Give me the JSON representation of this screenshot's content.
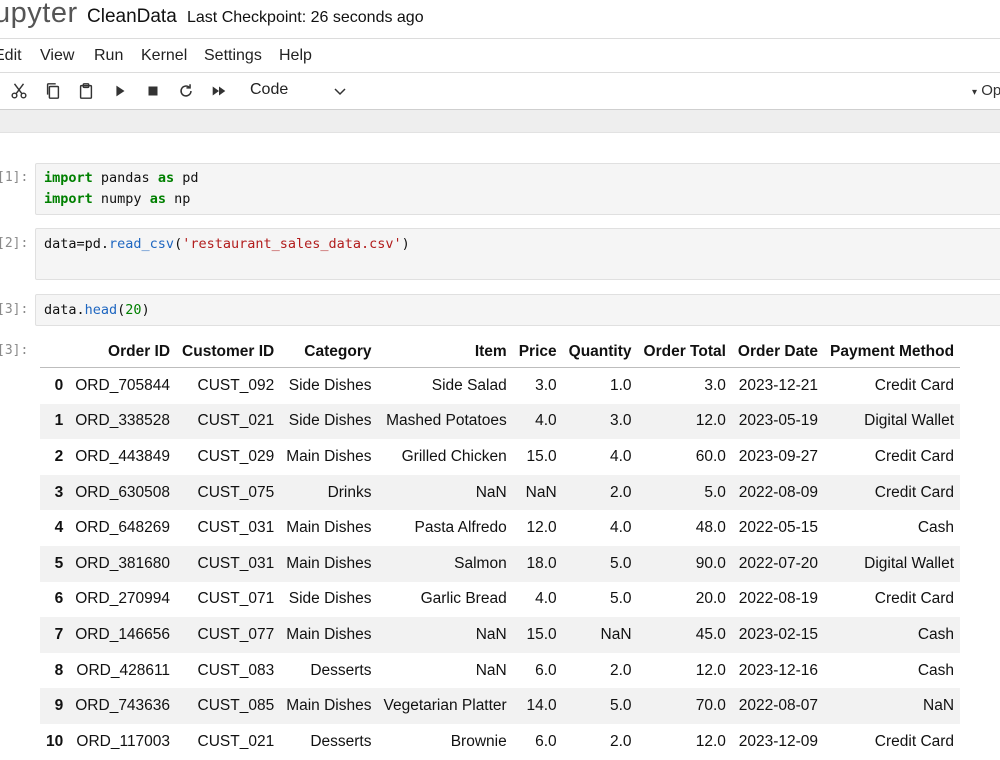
{
  "header": {
    "logo_text": "upyter",
    "notebook_title": "CleanData",
    "checkpoint": "Last Checkpoint: 26 seconds ago"
  },
  "menu": [
    "Edit",
    "View",
    "Run",
    "Kernel",
    "Settings",
    "Help"
  ],
  "toolbar": {
    "icons": [
      "cut-icon",
      "copy-icon",
      "paste-icon",
      "run-icon",
      "stop-icon",
      "restart-icon",
      "fast-forward-icon"
    ],
    "cell_type": "Code",
    "right_text": "Op"
  },
  "cells": [
    {
      "prompt": "[1]:",
      "lines": [
        "import pandas as pd",
        "import numpy as np"
      ]
    },
    {
      "prompt": "[2]:",
      "lines": [
        "data=pd.read_csv('restaurant_sales_data.csv')"
      ]
    },
    {
      "prompt": "[3]:",
      "lines": [
        "data.head(20)"
      ]
    }
  ],
  "output": {
    "prompt": "[3]:",
    "columns": [
      "",
      "Order ID",
      "Customer ID",
      "Category",
      "Item",
      "Price",
      "Quantity",
      "Order Total",
      "Order Date",
      "Payment Method"
    ],
    "rows": [
      [
        "0",
        "ORD_705844",
        "CUST_092",
        "Side Dishes",
        "Side Salad",
        "3.0",
        "1.0",
        "3.0",
        "2023-12-21",
        "Credit Card"
      ],
      [
        "1",
        "ORD_338528",
        "CUST_021",
        "Side Dishes",
        "Mashed Potatoes",
        "4.0",
        "3.0",
        "12.0",
        "2023-05-19",
        "Digital Wallet"
      ],
      [
        "2",
        "ORD_443849",
        "CUST_029",
        "Main Dishes",
        "Grilled Chicken",
        "15.0",
        "4.0",
        "60.0",
        "2023-09-27",
        "Credit Card"
      ],
      [
        "3",
        "ORD_630508",
        "CUST_075",
        "Drinks",
        "NaN",
        "NaN",
        "2.0",
        "5.0",
        "2022-08-09",
        "Credit Card"
      ],
      [
        "4",
        "ORD_648269",
        "CUST_031",
        "Main Dishes",
        "Pasta Alfredo",
        "12.0",
        "4.0",
        "48.0",
        "2022-05-15",
        "Cash"
      ],
      [
        "5",
        "ORD_381680",
        "CUST_031",
        "Main Dishes",
        "Salmon",
        "18.0",
        "5.0",
        "90.0",
        "2022-07-20",
        "Digital Wallet"
      ],
      [
        "6",
        "ORD_270994",
        "CUST_071",
        "Side Dishes",
        "Garlic Bread",
        "4.0",
        "5.0",
        "20.0",
        "2022-08-19",
        "Credit Card"
      ],
      [
        "7",
        "ORD_146656",
        "CUST_077",
        "Main Dishes",
        "NaN",
        "15.0",
        "NaN",
        "45.0",
        "2023-02-15",
        "Cash"
      ],
      [
        "8",
        "ORD_428611",
        "CUST_083",
        "Desserts",
        "NaN",
        "6.0",
        "2.0",
        "12.0",
        "2023-12-16",
        "Cash"
      ],
      [
        "9",
        "ORD_743636",
        "CUST_085",
        "Main Dishes",
        "Vegetarian Platter",
        "14.0",
        "5.0",
        "70.0",
        "2022-08-07",
        "NaN"
      ],
      [
        "10",
        "ORD_117003",
        "CUST_021",
        "Desserts",
        "Brownie",
        "6.0",
        "2.0",
        "12.0",
        "2023-12-09",
        "Credit Card"
      ]
    ]
  }
}
